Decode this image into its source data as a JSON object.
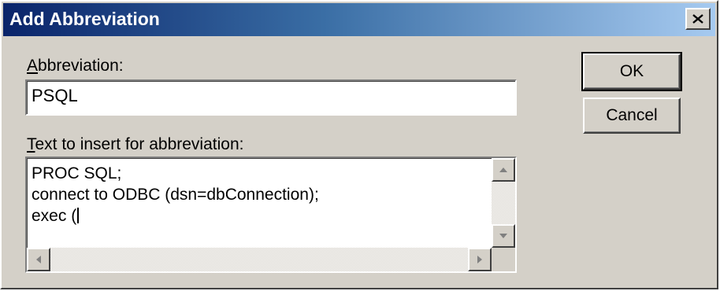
{
  "window": {
    "title": "Add Abbreviation",
    "close_icon": "close-icon"
  },
  "abbreviation": {
    "label_mnemonic": "A",
    "label_rest": "bbreviation:",
    "value": "PSQL"
  },
  "insert_text": {
    "label_mnemonic": "T",
    "label_rest": "ext to insert for abbreviation:",
    "lines": [
      "PROC SQL;",
      "connect to ODBC (dsn=dbConnection);",
      "exec ("
    ]
  },
  "buttons": {
    "ok": "OK",
    "cancel": "Cancel"
  },
  "colors": {
    "face": "#d4d0c8",
    "title_start": "#0a246a",
    "title_end": "#a6caf0"
  }
}
